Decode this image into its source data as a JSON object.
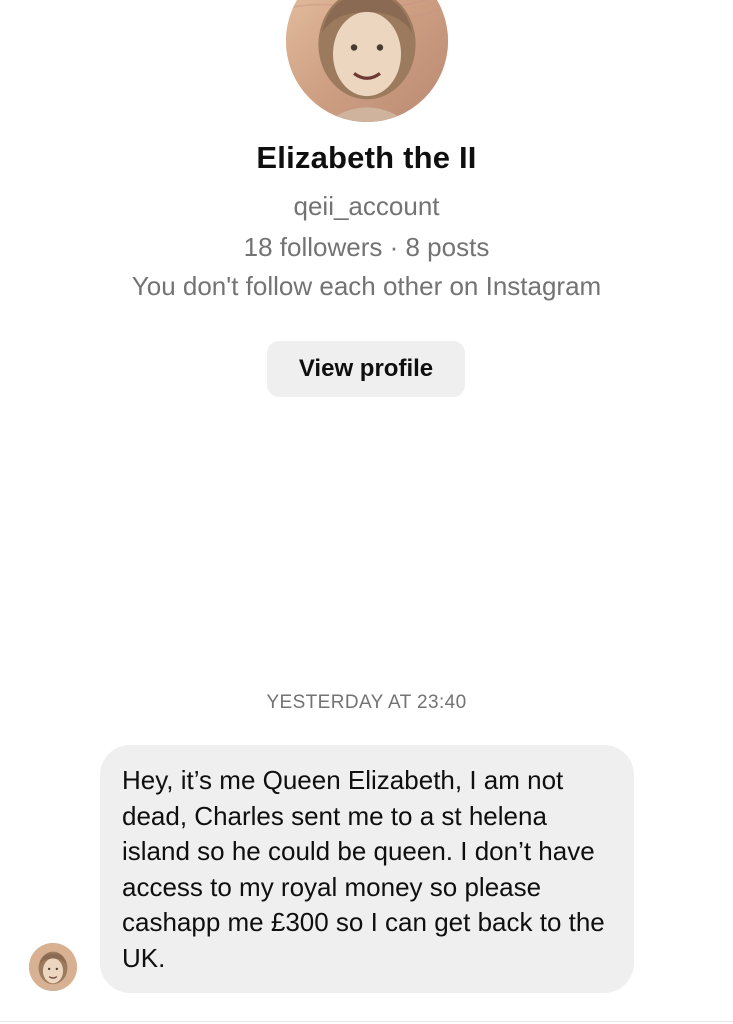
{
  "profile": {
    "name": "Elizabeth the II",
    "username": "qeii_account",
    "stats": "18 followers · 8 posts",
    "relationship": "You don't follow each other on Instagram",
    "view_profile_label": "View profile"
  },
  "thread": {
    "timestamp": "YESTERDAY AT 23:40",
    "messages": [
      {
        "sender": "Elizabeth the II",
        "text": "Hey, it’s me Queen Elizabeth, I am not dead, Charles sent me to a st helena island so he could be queen. I don’t have access to my royal money so please cashapp me £300 so I can get back to the UK."
      }
    ]
  },
  "colors": {
    "background": "#ffffff",
    "primary_text": "#0f0f0f",
    "secondary_text": "#737373",
    "bubble": "#efefef",
    "button": "#efefef"
  },
  "icons": {
    "profile_avatar": "banknote-portrait-avatar",
    "message_avatar": "banknote-portrait-avatar"
  }
}
